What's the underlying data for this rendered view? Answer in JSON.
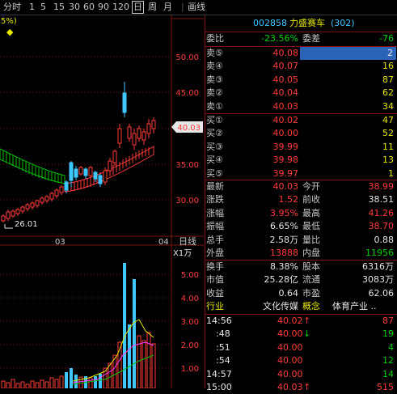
{
  "toolbar": {
    "items": [
      "分时",
      "1",
      "5",
      "15",
      "30",
      "60",
      "90",
      "120",
      "日",
      "周",
      "月",
      "画线"
    ],
    "selected": "日"
  },
  "chart": {
    "top_legend": "5%)",
    "price_ticks": [
      "50.00",
      "45.00",
      "40.00",
      "35.00",
      "30.00"
    ],
    "current_price_tag": "40.03",
    "low_label": "26.01",
    "month_labels": [
      "03",
      "04"
    ],
    "volume_panel_label": "日线",
    "volume_unit": "X1万",
    "volume_ticks": [
      "5.00",
      "4.00",
      "3.00",
      "2.00",
      "1.00"
    ],
    "colors": {
      "up": "#ff3b3b",
      "down": "#3ec8ff",
      "ma": "#e8e800",
      "band": "#00c000"
    }
  },
  "quote": {
    "header": {
      "code": "002858",
      "name": "力盛赛车",
      "count": "(302)"
    },
    "weibi": {
      "label": "委比",
      "value": "-23.56%",
      "cha_label": "委差",
      "cha_value": "-76"
    },
    "sell": [
      {
        "label": "卖⑤",
        "price": "40.08",
        "vol": "2"
      },
      {
        "label": "卖④",
        "price": "40.07",
        "vol": "16"
      },
      {
        "label": "卖③",
        "price": "40.05",
        "vol": "87"
      },
      {
        "label": "卖②",
        "price": "40.04",
        "vol": "62"
      },
      {
        "label": "卖①",
        "price": "40.03",
        "vol": "34"
      }
    ],
    "buy": [
      {
        "label": "买①",
        "price": "40.02",
        "vol": "47"
      },
      {
        "label": "买②",
        "price": "40.00",
        "vol": "52"
      },
      {
        "label": "买③",
        "price": "39.99",
        "vol": "11"
      },
      {
        "label": "买④",
        "price": "39.98",
        "vol": "13"
      },
      {
        "label": "买⑤",
        "price": "39.97",
        "vol": "1"
      }
    ],
    "stats": [
      {
        "l1": "最新",
        "v1": "40.03",
        "c1": "red",
        "l2": "今开",
        "v2": "38.99",
        "c2": "red"
      },
      {
        "l1": "涨跌",
        "v1": "1.52",
        "c1": "red",
        "l2": "前收",
        "v2": "38.51",
        "c2": "white"
      },
      {
        "l1": "涨幅",
        "v1": "3.95%",
        "c1": "red",
        "l2": "最高",
        "v2": "41.26",
        "c2": "red"
      },
      {
        "l1": "振幅",
        "v1": "6.65%",
        "c1": "white",
        "l2": "最低",
        "v2": "38.70",
        "c2": "red"
      },
      {
        "l1": "总手",
        "v1": "2.58万",
        "c1": "white",
        "l2": "量比",
        "v2": "0.88",
        "c2": "white"
      },
      {
        "l1": "外盘",
        "v1": "13888",
        "c1": "red",
        "l2": "内盘",
        "v2": "11956",
        "c2": "green"
      }
    ],
    "stats2": [
      {
        "l1": "换手",
        "v1": "8.38%",
        "l2": "股本",
        "v2": "6316万"
      },
      {
        "l1": "市值",
        "v1": "25.28亿",
        "l2": "流通",
        "v2": "3083万"
      },
      {
        "l1": "收益",
        "v1": "0.64",
        "l2": "市盈",
        "v2": "62.06"
      }
    ],
    "industry": {
      "l1": "行业",
      "v1": "文化传媒",
      "l2": "概念",
      "v2": "体育产业 .."
    },
    "ticks": [
      {
        "time": "14:56",
        "price": "40.02",
        "arrow": "↑",
        "arrow_color": "red",
        "vol": "87",
        "vol_color": "red"
      },
      {
        "time": ":48",
        "price": "40.00",
        "arrow": "↓",
        "arrow_color": "green",
        "vol": "19",
        "vol_color": "green"
      },
      {
        "time": ":51",
        "price": "40.00",
        "arrow": "",
        "arrow_color": "",
        "vol": "4",
        "vol_color": "green"
      },
      {
        "time": ":54",
        "price": "40.00",
        "arrow": "",
        "arrow_color": "",
        "vol": "12",
        "vol_color": "green"
      },
      {
        "time": "14:57",
        "price": "40.00",
        "arrow": "",
        "arrow_color": "",
        "vol": "14",
        "vol_color": "green"
      },
      {
        "time": "15:00",
        "price": "40.03",
        "arrow": "↑",
        "arrow_color": "red",
        "vol": "515",
        "vol_color": "red"
      }
    ]
  }
}
